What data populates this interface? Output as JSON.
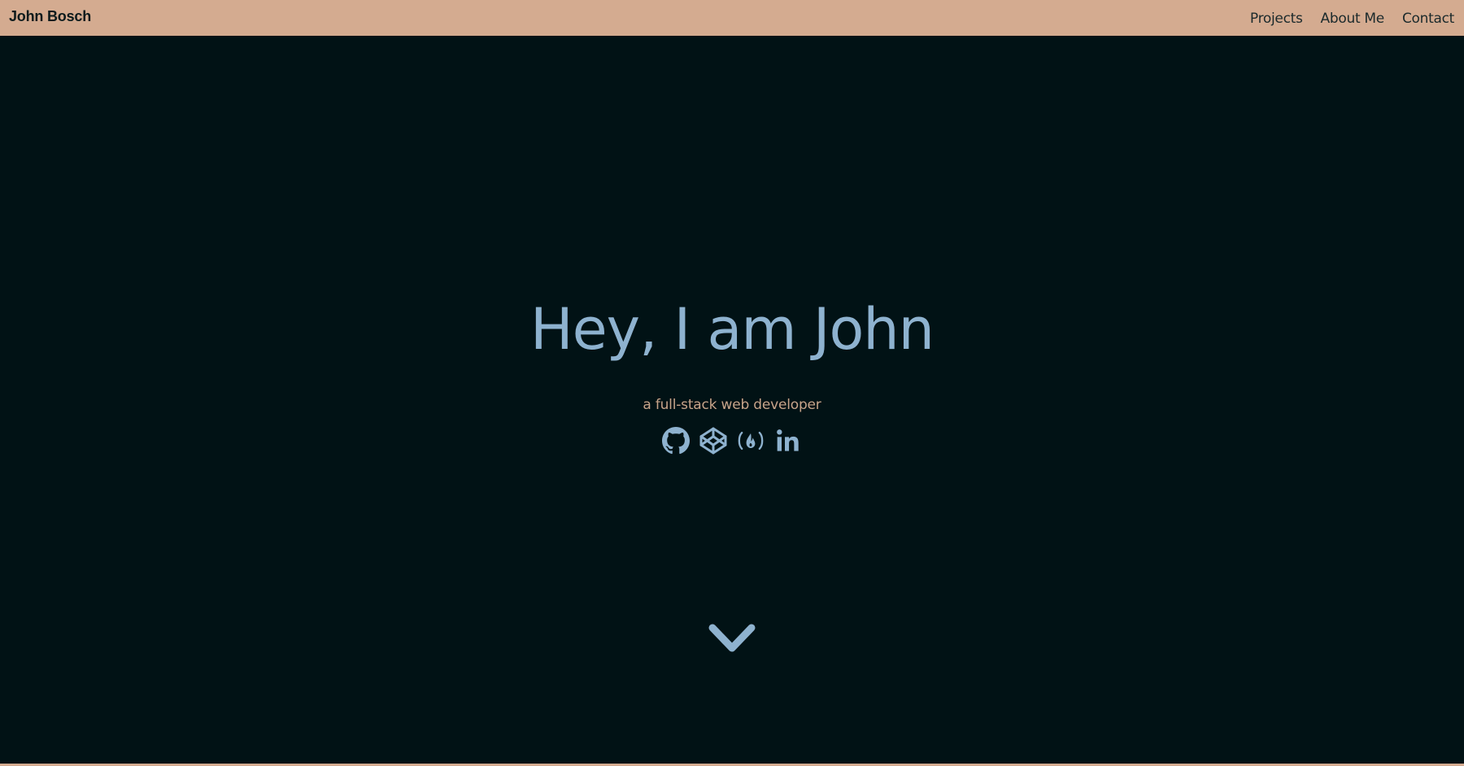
{
  "navbar": {
    "brand": "John Bosch",
    "links": [
      {
        "label": "Projects"
      },
      {
        "label": "About Me"
      },
      {
        "label": "Contact"
      }
    ]
  },
  "hero": {
    "title": "Hey, I am John",
    "subtitle": "a full-stack web developer",
    "social_icons": [
      "github-icon",
      "codepen-icon",
      "freecodecamp-icon",
      "linkedin-icon"
    ],
    "scroll_icon": "chevron-down-icon"
  },
  "colors": {
    "navbar_bg": "#d4ab90",
    "page_bg": "#011215",
    "accent_blue": "#8eb2cf",
    "accent_tan": "#c8a48a"
  }
}
